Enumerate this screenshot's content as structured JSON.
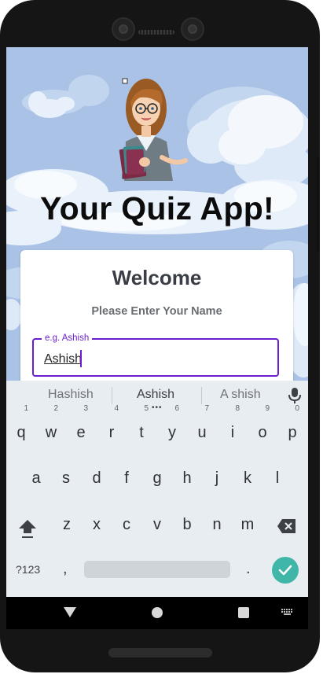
{
  "app": {
    "title": "Your Quiz App!"
  },
  "card": {
    "heading": "Welcome",
    "prompt": "Please Enter Your Name",
    "name_field": {
      "label": "e.g. Ashish",
      "value": "Ashish"
    }
  },
  "keyboard": {
    "suggestions": [
      "Hashish",
      "Ashish",
      "A shish"
    ],
    "row1": [
      {
        "key": "q",
        "hint": "1"
      },
      {
        "key": "w",
        "hint": "2"
      },
      {
        "key": "e",
        "hint": "3"
      },
      {
        "key": "r",
        "hint": "4"
      },
      {
        "key": "t",
        "hint": "5"
      },
      {
        "key": "y",
        "hint": "6"
      },
      {
        "key": "u",
        "hint": "7"
      },
      {
        "key": "i",
        "hint": "8"
      },
      {
        "key": "o",
        "hint": "9"
      },
      {
        "key": "p",
        "hint": "0"
      }
    ],
    "row2": [
      "a",
      "s",
      "d",
      "f",
      "g",
      "h",
      "j",
      "k",
      "l"
    ],
    "row3": [
      "z",
      "x",
      "c",
      "v",
      "b",
      "n",
      "m"
    ],
    "symbols_label": "?123",
    "comma": ",",
    "period": "."
  },
  "icons": {
    "mic": "mic-icon",
    "shift": "shift-icon",
    "backspace": "backspace-icon",
    "enter": "check-icon",
    "nav_back": "back-triangle-icon",
    "nav_home": "home-circle-icon",
    "nav_recent": "recents-square-icon",
    "nav_keyboard": "keyboard-icon"
  },
  "colors": {
    "accent": "#6a1fcf",
    "enter_key": "#3fb6a8",
    "sky": "#aac3e6"
  }
}
